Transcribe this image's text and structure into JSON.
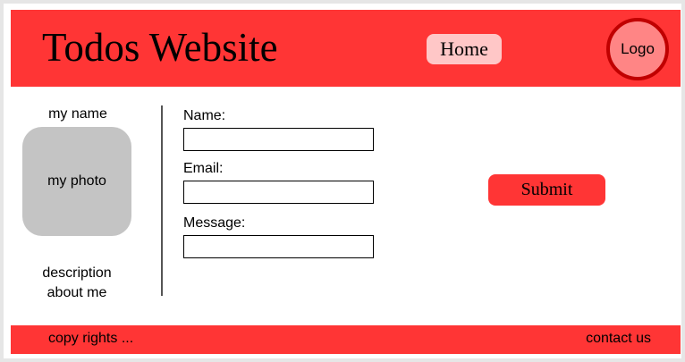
{
  "header": {
    "title": "Todos Website",
    "home_label": "Home",
    "logo_label": "Logo"
  },
  "sidebar": {
    "name": "my name",
    "photo_label": "my photo",
    "description": "description about me"
  },
  "form": {
    "name_label": "Name:",
    "name_value": "",
    "email_label": "Email:",
    "email_value": "",
    "message_label": "Message:",
    "message_value": "",
    "submit_label": "Submit"
  },
  "footer": {
    "copyright": "copy rights ...",
    "contact": "contact us"
  },
  "colors": {
    "accent": "#ff3535",
    "home_button": "#ffc7c7",
    "logo_fill": "#ff8585",
    "logo_border": "#c00000",
    "photo_placeholder": "#c4c4c4"
  }
}
